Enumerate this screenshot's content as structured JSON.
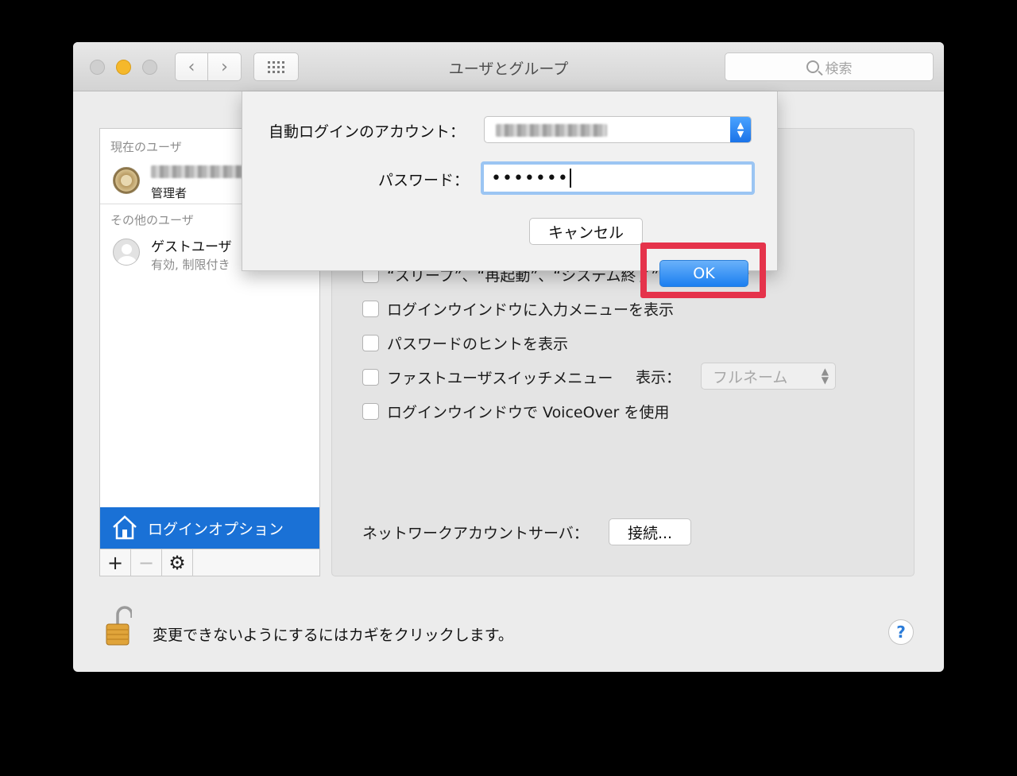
{
  "window": {
    "title": "ユーザとグループ",
    "search_placeholder": "検索"
  },
  "sidebar": {
    "current_users_header": "現在のユーザ",
    "current_user": {
      "name": "",
      "role": "管理者"
    },
    "other_users_header": "その他のユーザ",
    "guest": {
      "name": "ゲストユーザ",
      "status": "有効, 制限付き"
    },
    "login_options_label": "ログインオプション",
    "tools": {
      "add": "+",
      "remove": "−",
      "settings": "⚙"
    }
  },
  "options": {
    "items": [
      "“スリープ”、“再起動”、“システム終了”ボタンを表示",
      "ログインウインドウに入力メニューを表示",
      "パスワードのヒントを表示",
      "ファストユーザスイッチメニュー",
      "ログインウインドウで VoiceOver を使用"
    ],
    "fast_user_show_label": "表示：",
    "fast_user_show_value": "フルネーム",
    "network_server_label": "ネットワークアカウントサーバ：",
    "connect_button": "接続..."
  },
  "footer": {
    "lock_text": "変更できないようにするにはカギをクリックします。",
    "help": "?"
  },
  "sheet": {
    "auto_login_label": "自動ログインのアカウント：",
    "auto_login_value": "",
    "password_label": "パスワード：",
    "password_value": "•••••••",
    "cancel_button": "キャンセル",
    "ok_button": "OK"
  },
  "colors": {
    "accent": "#1a71d6",
    "highlight": "#e5334b",
    "minimize": "#f5b82b"
  }
}
